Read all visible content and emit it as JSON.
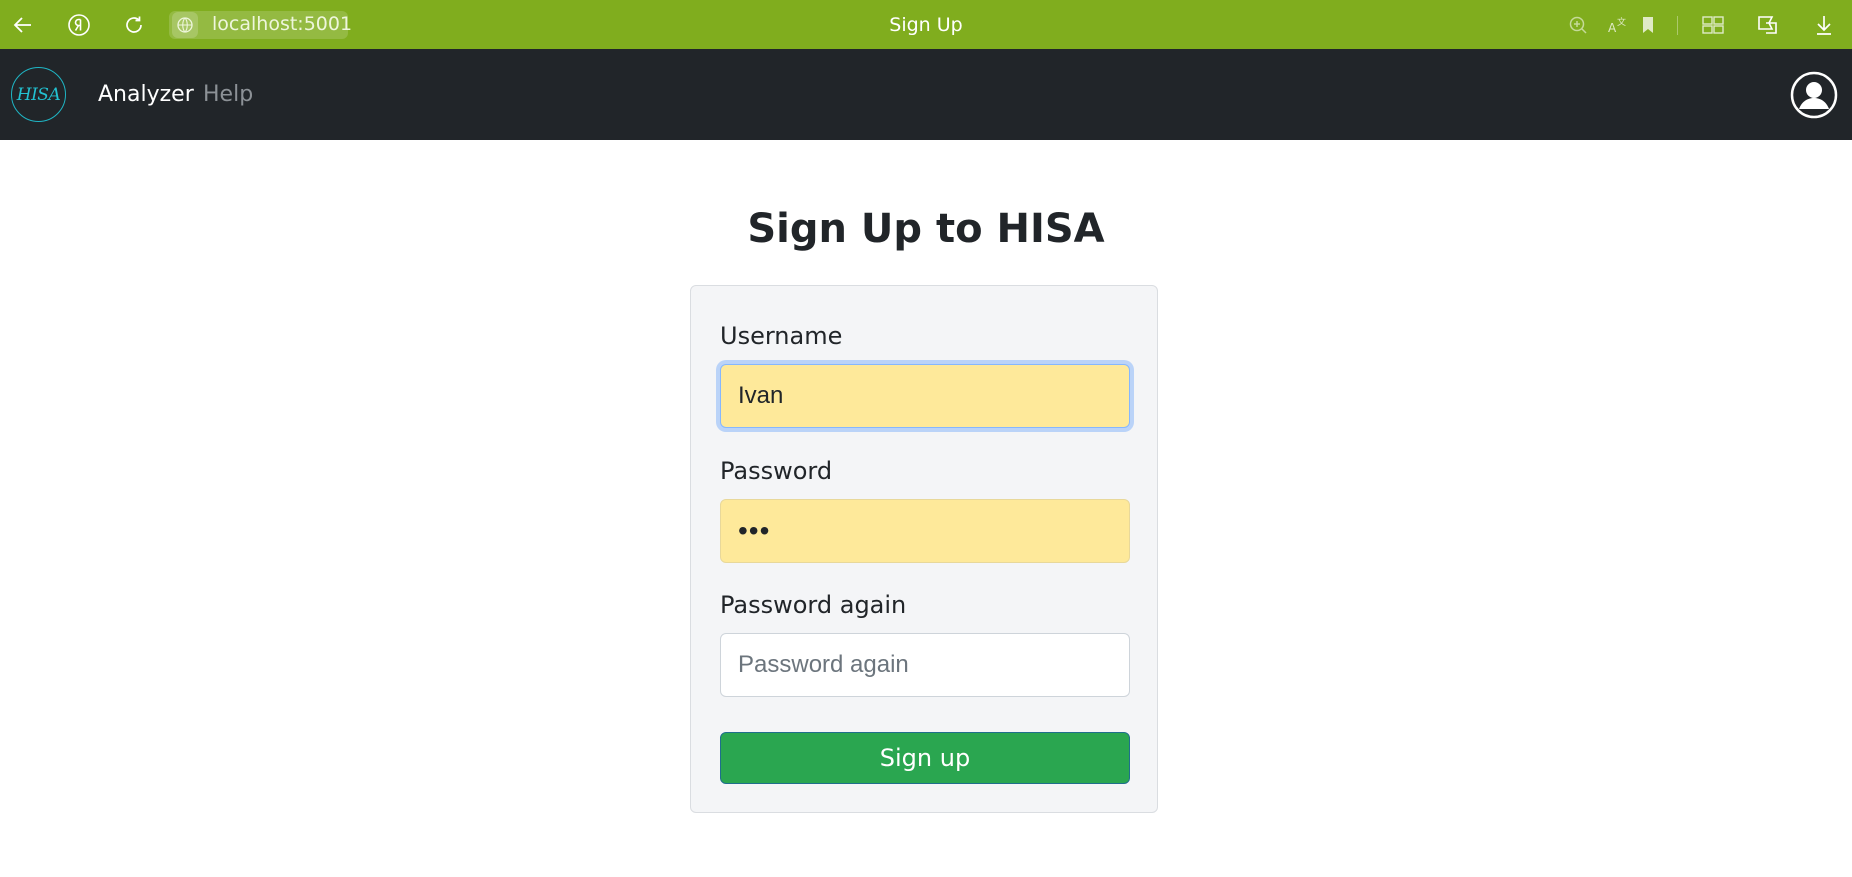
{
  "browser": {
    "url": "localhost:5001",
    "tab_title": "Sign Up",
    "icons": [
      "back-arrow-icon",
      "yandex-icon",
      "reload-icon",
      "site-info-icon",
      "zoom-icon",
      "translate-icon",
      "bookmark-icon",
      "extensions-icon",
      "reader-icon",
      "download-icon"
    ]
  },
  "navbar": {
    "logo_text": "HISA",
    "links": [
      "Analyzer",
      "Help"
    ],
    "profile_icon": "user-circle-icon"
  },
  "main": {
    "title": "Sign Up to HISA",
    "form": {
      "username_label": "Username",
      "username_value": "Ivan",
      "password_label": "Password",
      "password_mask": "•••",
      "password_again_label": "Password again",
      "password_again_placeholder": "Password again",
      "submit_label": "Sign up"
    }
  },
  "colors": {
    "browser_bar": "#80ad1e",
    "navbar": "#212529",
    "logo_accent": "#22c1d1",
    "autofill": "#fee99a",
    "submit": "#2aa650",
    "card": "#f4f5f7"
  }
}
